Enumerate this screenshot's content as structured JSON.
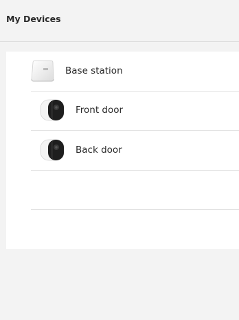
{
  "header": {
    "title": "My Devices"
  },
  "devices": [
    {
      "label": "Base station",
      "icon": "base-station-icon"
    },
    {
      "label": "Front door",
      "icon": "camera-icon"
    },
    {
      "label": "Back door",
      "icon": "camera-icon"
    }
  ],
  "colors": {
    "background": "#f3f3f3",
    "card": "#ffffff",
    "divider": "#e2e2e2",
    "text": "#2a2a2a"
  }
}
